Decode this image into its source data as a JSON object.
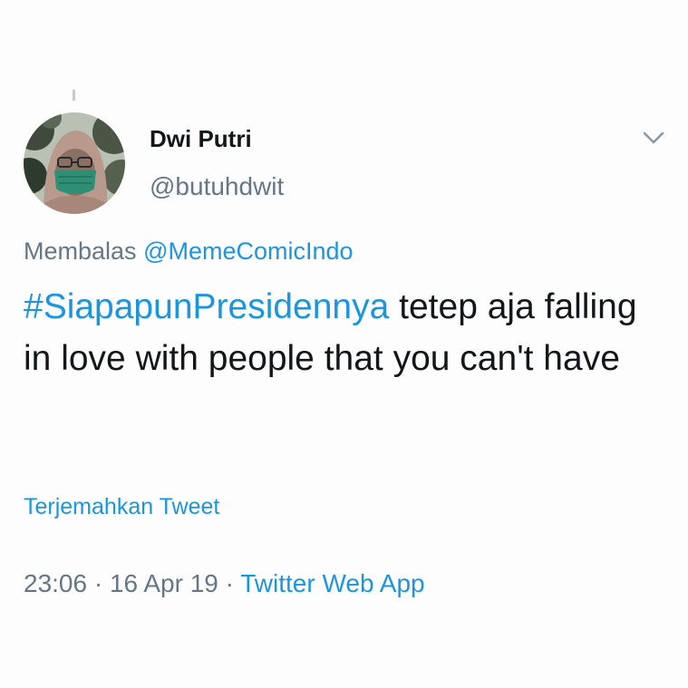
{
  "tweet": {
    "author": {
      "display_name": "Dwi Putri",
      "handle": "@butuhdwit"
    },
    "reply": {
      "prefix": "Membalas",
      "mention": "@MemeComicIndo"
    },
    "text": {
      "hashtag": "#SiapapunPresidennya",
      "body": " tetep aja falling in love with people that you can't have"
    },
    "translate_label": "Terjemahkan Tweet",
    "meta": {
      "time": "23:06",
      "separator": "·",
      "date": "16 Apr 19",
      "source": "Twitter Web App"
    }
  },
  "icons": {
    "menu": "chevron-down-icon"
  },
  "colors": {
    "link": "#1b95e0",
    "secondary_text": "#657786",
    "primary_text": "#14171a",
    "background": "#fdfdfd"
  }
}
